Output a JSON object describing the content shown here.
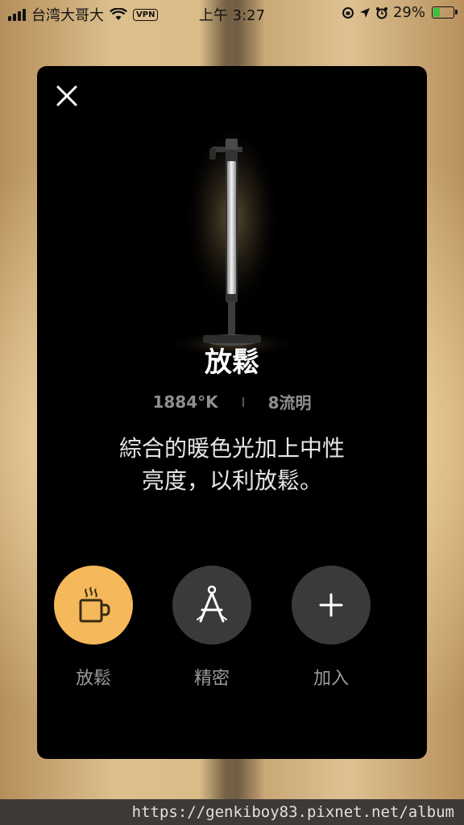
{
  "status_bar": {
    "carrier": "台湾大哥大",
    "vpn": "VPN",
    "time": "上午 3:27",
    "battery_percent": "29%",
    "icons": [
      "signal-icon",
      "wifi-icon",
      "vpn-badge",
      "lock-rotation-icon",
      "location-icon",
      "alarm-icon",
      "battery-icon"
    ]
  },
  "card": {
    "close_icon": "close-icon",
    "mode_title": "放鬆",
    "color_temperature": "1884°K",
    "brightness": "8流明",
    "description_line1": "綜合的暖色光加上中性",
    "description_line2": "亮度，以利放鬆。",
    "modes": [
      {
        "label": "放鬆",
        "icon": "coffee-cup-icon",
        "color": "#f5b95c",
        "selected": true
      },
      {
        "label": "精密",
        "icon": "compass-icon",
        "color": "#3a3a3a",
        "selected": false
      },
      {
        "label": "加入",
        "icon": "plus-icon",
        "color": "#3a3a3a",
        "selected": false
      }
    ]
  },
  "footer": {
    "watermark": "https://genkiboy83.pixnet.net/album"
  },
  "colors": {
    "accent": "#f5b95c",
    "card_bg": "#000000",
    "inactive_circle": "#3a3a3a"
  }
}
